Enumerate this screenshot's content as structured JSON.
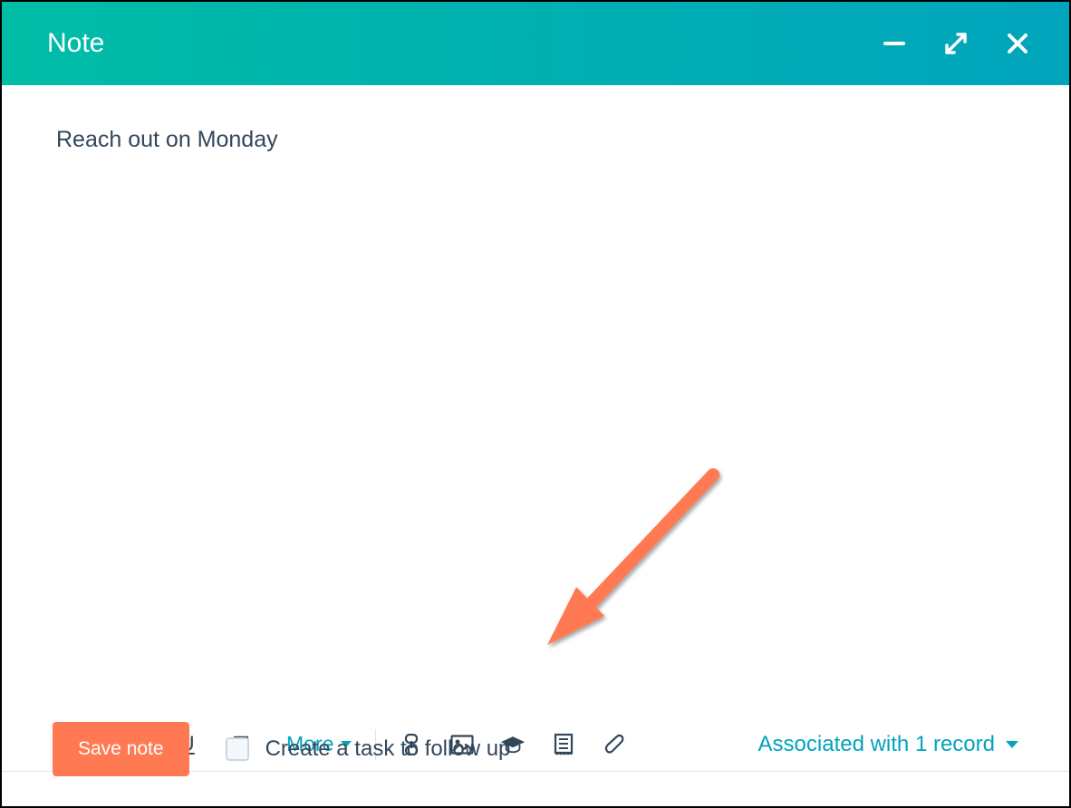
{
  "header": {
    "title": "Note"
  },
  "note": {
    "content": "Reach out on Monday"
  },
  "toolbar": {
    "more_label": "More",
    "associated_label": "Associated with 1 record"
  },
  "footer": {
    "save_label": "Save note",
    "task_label": "Create a task to follow up"
  }
}
